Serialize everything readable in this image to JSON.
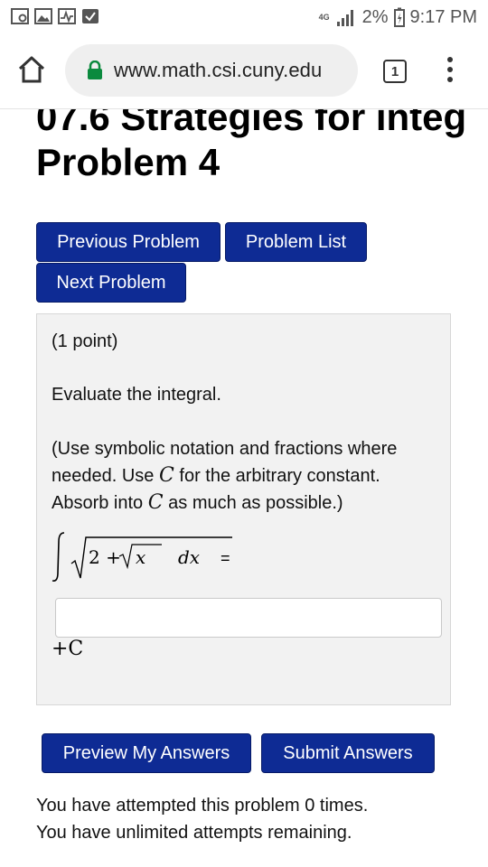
{
  "status_bar": {
    "network": "4G",
    "battery": "2%",
    "time": "9:17 PM"
  },
  "browser": {
    "url": "www.math.csi.cuny.edu",
    "tab_count": "1"
  },
  "page": {
    "title_line1": "07.6 Strategies for integ",
    "title_line2": "Problem 4",
    "nav_buttons": {
      "previous": "Previous Problem",
      "list": "Problem List",
      "next": "Next Problem"
    },
    "problem": {
      "points": "(1 point)",
      "prompt": "Evaluate the integral.",
      "instructions_1": "(Use symbolic notation and fractions where",
      "instructions_2a": "needed. Use",
      "instructions_2b": "for the arbitrary constant.",
      "instructions_3a": "Absorb into",
      "instructions_3b": "as much as possible.)",
      "constant_symbol": "C",
      "integral_expression": "∫ √(2 + √x) dx =",
      "answer_value": "",
      "suffix": "+C"
    },
    "actions": {
      "preview": "Preview My Answers",
      "submit": "Submit Answers"
    },
    "attempts_line1": "You have attempted this problem 0 times.",
    "attempts_line2": "You have unlimited attempts remaining."
  },
  "colors": {
    "button_bg": "#0e2b94",
    "lock_green": "#0b8a3e",
    "problem_bg": "#f2f2f2"
  }
}
